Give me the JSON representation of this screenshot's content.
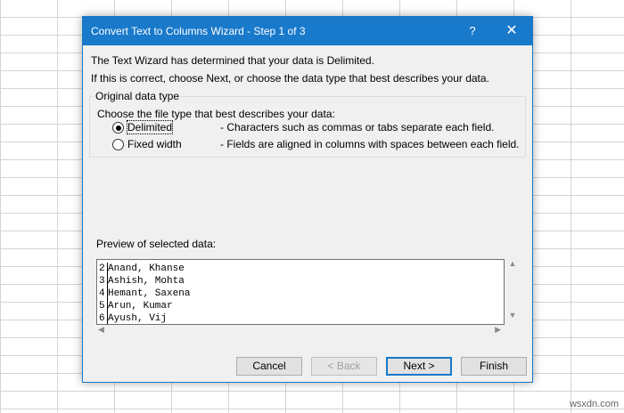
{
  "dialog": {
    "title": "Convert Text to Columns Wizard - Step 1 of 3",
    "help_glyph": "?",
    "close_glyph": "✕",
    "message1": "The Text Wizard has determined that your data is Delimited.",
    "message2": "If this is correct, choose Next, or choose the data type that best describes your data.",
    "group_title": "Original data type",
    "choose_label": "Choose the file type that best describes your data:",
    "options": [
      {
        "label": "Delimited",
        "description": "- Characters such as commas or tabs separate each field.",
        "selected": true
      },
      {
        "label": "Fixed width",
        "description": "- Fields are aligned in columns with spaces between each field.",
        "selected": false
      }
    ],
    "preview_label": "Preview of selected data:",
    "preview_rows": [
      {
        "num": "2",
        "text": "Anand, Khanse"
      },
      {
        "num": "3",
        "text": "Ashish, Mohta"
      },
      {
        "num": "4",
        "text": "Hemant, Saxena"
      },
      {
        "num": "5",
        "text": "Arun, Kumar"
      },
      {
        "num": "6",
        "text": "Ayush, Vij"
      }
    ],
    "buttons": {
      "cancel": "Cancel",
      "back": "< Back",
      "next": "Next >",
      "finish": "Finish"
    }
  },
  "watermark": "wsxdn.com",
  "colors": {
    "accent": "#1979ca",
    "dialog_bg": "#f0f0f0",
    "disabled_text": "#a0a0a0"
  },
  "icons": {
    "help": "help-icon",
    "close": "close-icon",
    "scroll_up": "chevron-up-icon",
    "scroll_down": "chevron-down-icon",
    "scroll_left": "chevron-left-icon",
    "scroll_right": "chevron-right-icon"
  }
}
